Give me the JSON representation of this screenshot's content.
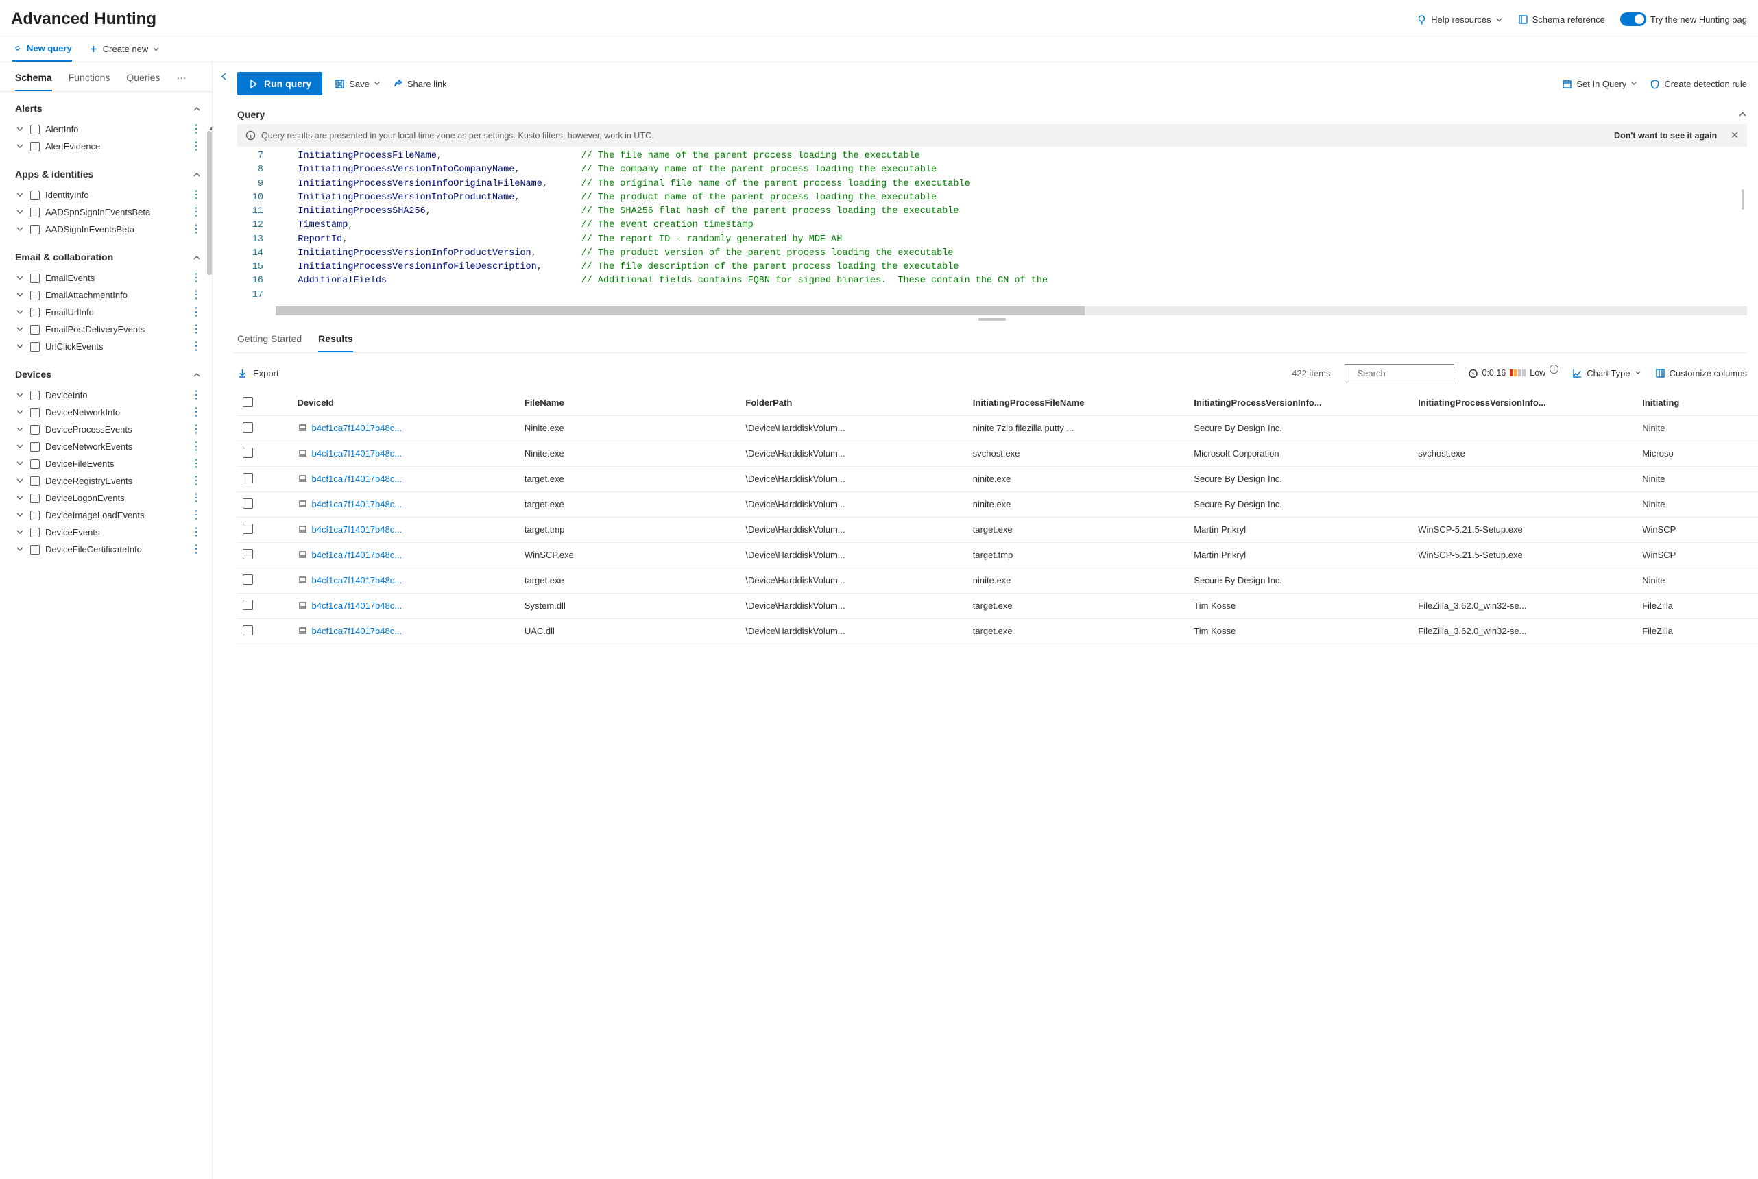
{
  "header": {
    "title": "Advanced Hunting",
    "help": "Help resources",
    "schemaRef": "Schema reference",
    "tryNew": "Try the new Hunting pag"
  },
  "tabbar": {
    "newQuery": "New query",
    "createNew": "Create new"
  },
  "sidebar": {
    "tabs": {
      "schema": "Schema",
      "functions": "Functions",
      "queries": "Queries"
    },
    "sections": [
      {
        "title": "Alerts",
        "items": [
          "AlertInfo",
          "AlertEvidence"
        ]
      },
      {
        "title": "Apps & identities",
        "items": [
          "IdentityInfo",
          "AADSpnSignInEventsBeta",
          "AADSignInEventsBeta"
        ]
      },
      {
        "title": "Email & collaboration",
        "items": [
          "EmailEvents",
          "EmailAttachmentInfo",
          "EmailUrlInfo",
          "EmailPostDeliveryEvents",
          "UrlClickEvents"
        ]
      },
      {
        "title": "Devices",
        "items": [
          "DeviceInfo",
          "DeviceNetworkInfo",
          "DeviceProcessEvents",
          "DeviceNetworkEvents",
          "DeviceFileEvents",
          "DeviceRegistryEvents",
          "DeviceLogonEvents",
          "DeviceImageLoadEvents",
          "DeviceEvents",
          "DeviceFileCertificateInfo"
        ]
      }
    ]
  },
  "toolbar": {
    "run": "Run query",
    "save": "Save",
    "share": "Share link",
    "setInQuery": "Set In Query",
    "createRule": "Create detection rule"
  },
  "querySection": {
    "title": "Query",
    "bannerText": "Query results are presented in your local time zone as per settings. Kusto filters, however, work in UTC.",
    "bannerDismiss": "Don't want to see it again"
  },
  "code": [
    {
      "n": 7,
      "field": "InitiatingProcessFileName",
      "commentPad": "                         ",
      "comment": "// The file name of the parent process loading the executable"
    },
    {
      "n": 8,
      "field": "InitiatingProcessVersionInfoCompanyName",
      "commentPad": "           ",
      "comment": "// The company name of the parent process loading the executable"
    },
    {
      "n": 9,
      "field": "InitiatingProcessVersionInfoOriginalFileName",
      "commentPad": "      ",
      "comment": "// The original file name of the parent process loading the executable"
    },
    {
      "n": 10,
      "field": "InitiatingProcessVersionInfoProductName",
      "commentPad": "           ",
      "comment": "// The product name of the parent process loading the executable"
    },
    {
      "n": 11,
      "field": "InitiatingProcessSHA256",
      "commentPad": "                           ",
      "comment": "// The SHA256 flat hash of the parent process loading the executable"
    },
    {
      "n": 12,
      "field": "Timestamp",
      "commentPad": "                                         ",
      "comment": "// The event creation timestamp"
    },
    {
      "n": 13,
      "field": "ReportId",
      "commentPad": "                                          ",
      "comment": "// The report ID - randomly generated by MDE AH"
    },
    {
      "n": 14,
      "field": "InitiatingProcessVersionInfoProductVersion",
      "commentPad": "        ",
      "comment": "// The product version of the parent process loading the executable"
    },
    {
      "n": 15,
      "field": "InitiatingProcessVersionInfoFileDescription",
      "commentPad": "       ",
      "comment": "// The file description of the parent process loading the executable"
    },
    {
      "n": 16,
      "field": "AdditionalFields",
      "commentPad": "                                   ",
      "comment": "// Additional fields contains FQBN for signed binaries.  These contain the CN of the",
      "noComma": true
    },
    {
      "n": 17,
      "field": "",
      "commentPad": "",
      "comment": "",
      "noComma": true
    }
  ],
  "resultsTabs": {
    "start": "Getting Started",
    "results": "Results"
  },
  "resultsBar": {
    "export": "Export",
    "itemsCount": "422 items",
    "searchPlaceholder": "Search",
    "elapsed": "0:0.16",
    "low": "Low",
    "chartType": "Chart Type",
    "customize": "Customize columns"
  },
  "table": {
    "columns": [
      "DeviceId",
      "FileName",
      "FolderPath",
      "InitiatingProcessFileName",
      "InitiatingProcessVersionInfo...",
      "InitiatingProcessVersionInfo...",
      "Initiating"
    ],
    "rows": [
      {
        "deviceId": "b4cf1ca7f14017b48c...",
        "fileName": "Ninite.exe",
        "folderPath": "\\Device\\HarddiskVolum...",
        "initFile": "ninite 7zip filezilla putty ...",
        "company": "Secure By Design Inc.",
        "origFile": "",
        "prod": "Ninite"
      },
      {
        "deviceId": "b4cf1ca7f14017b48c...",
        "fileName": "Ninite.exe",
        "folderPath": "\\Device\\HarddiskVolum...",
        "initFile": "svchost.exe",
        "company": "Microsoft Corporation",
        "origFile": "svchost.exe",
        "prod": "Microso"
      },
      {
        "deviceId": "b4cf1ca7f14017b48c...",
        "fileName": "target.exe",
        "folderPath": "\\Device\\HarddiskVolum...",
        "initFile": "ninite.exe",
        "company": "Secure By Design Inc.",
        "origFile": "",
        "prod": "Ninite"
      },
      {
        "deviceId": "b4cf1ca7f14017b48c...",
        "fileName": "target.exe",
        "folderPath": "\\Device\\HarddiskVolum...",
        "initFile": "ninite.exe",
        "company": "Secure By Design Inc.",
        "origFile": "",
        "prod": "Ninite"
      },
      {
        "deviceId": "b4cf1ca7f14017b48c...",
        "fileName": "target.tmp",
        "folderPath": "\\Device\\HarddiskVolum...",
        "initFile": "target.exe",
        "company": "Martin Prikryl",
        "origFile": "WinSCP-5.21.5-Setup.exe",
        "prod": "WinSCP"
      },
      {
        "deviceId": "b4cf1ca7f14017b48c...",
        "fileName": "WinSCP.exe",
        "folderPath": "\\Device\\HarddiskVolum...",
        "initFile": "target.tmp",
        "company": "Martin Prikryl",
        "origFile": "WinSCP-5.21.5-Setup.exe",
        "prod": "WinSCP"
      },
      {
        "deviceId": "b4cf1ca7f14017b48c...",
        "fileName": "target.exe",
        "folderPath": "\\Device\\HarddiskVolum...",
        "initFile": "ninite.exe",
        "company": "Secure By Design Inc.",
        "origFile": "",
        "prod": "Ninite"
      },
      {
        "deviceId": "b4cf1ca7f14017b48c...",
        "fileName": "System.dll",
        "folderPath": "\\Device\\HarddiskVolum...",
        "initFile": "target.exe",
        "company": "Tim Kosse",
        "origFile": "FileZilla_3.62.0_win32-se...",
        "prod": "FileZilla"
      },
      {
        "deviceId": "b4cf1ca7f14017b48c...",
        "fileName": "UAC.dll",
        "folderPath": "\\Device\\HarddiskVolum...",
        "initFile": "target.exe",
        "company": "Tim Kosse",
        "origFile": "FileZilla_3.62.0_win32-se...",
        "prod": "FileZilla"
      }
    ]
  }
}
